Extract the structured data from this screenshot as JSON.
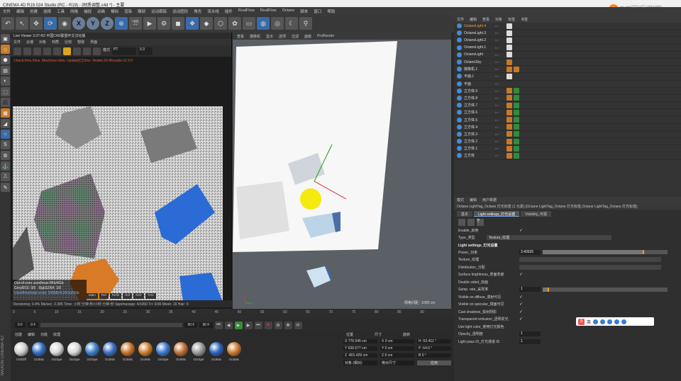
{
  "window": {
    "title": "CINEMA 4D R19.024 Studio (RC - R19) - [材质调整.c4d *] - 主要"
  },
  "brand": {
    "text": "CG帮手学堂"
  },
  "menu": [
    "文件",
    "编辑",
    "创建",
    "选择",
    "工具",
    "网格",
    "捕捉",
    "动画",
    "模拟",
    "渲染",
    "雕刻",
    "运动跟踪",
    "运动图形",
    "角色",
    "流水线",
    "插件",
    "RealFlow",
    "RealFlow",
    "Octane",
    "脚本",
    "窗口",
    "帮助"
  ],
  "toolbar": [
    "↶",
    "↖",
    "✥",
    "⟳",
    "◉",
    "X",
    "Y",
    "Z",
    "⊕",
    "🎬",
    "▶",
    "⚙",
    "◼",
    "❖",
    "◆",
    "⬡",
    "✿",
    "▭",
    "◍",
    "◎",
    "☾",
    "⚲"
  ],
  "left_tools": [
    "▣",
    "◇",
    "⬢",
    "▤",
    "◐",
    "⬚",
    "⬛",
    "▦",
    "◢",
    "⌂",
    "S",
    "⚙",
    "⚓",
    "⎍",
    "✎"
  ],
  "live_viewer": {
    "title": "Live Viewer 3.07-R2 中国C4D联盟中文汉化版",
    "menu": [
      "文件",
      "云端",
      "对象",
      "材质",
      "比较",
      "帮助",
      "界面"
    ],
    "kernel_label": "模式",
    "kernel_value": "PT",
    "kernel_num": "0.3",
    "status": "Check:0ms./0ms. MeshGen:0ms. Update[C]:0ms. Nodes:16 Movable:11 0:0",
    "info": [
      "Out-of-core used/max:0Kb/4Gb",
      "Grey8/16: 0/0",
      "Rgb32/64: 1/0",
      "Used/free/total vram: 566Mb/4.26Gb/6Gb"
    ],
    "info_tabs": [
      "Main",
      "Ref",
      "Refl2",
      "Ref",
      "Refr",
      "Trns"
    ],
    "bottom": "Rendering: 0.4%   Ms/sec: 2.385   Time: 小时:分钟:秒/小时:分钟:秒   Spp/maxspp: 4/1000   Tri: 0/36   Mesh: 16   Hair: 0"
  },
  "viewport": {
    "menu": [
      "查看",
      "摄像机",
      "显示",
      "选项",
      "过滤",
      "面板",
      "ProRender"
    ],
    "grid_label": "网格间距 : 1000 cm"
  },
  "object_manager": {
    "tabs": [
      "文件",
      "编辑",
      "查看",
      "对象",
      "标签",
      "书签"
    ],
    "objects": [
      {
        "name": "OctaneLight.4",
        "selected": true,
        "tags": [
          "w"
        ]
      },
      {
        "name": "OctaneLight.3",
        "selected": false,
        "tags": [
          "w"
        ]
      },
      {
        "name": "OctaneLight.2",
        "selected": false,
        "tags": [
          "w"
        ]
      },
      {
        "name": "OctaneLight.1",
        "selected": false,
        "tags": [
          "w"
        ]
      },
      {
        "name": "OctaneLight",
        "selected": false,
        "tags": [
          "w"
        ]
      },
      {
        "name": "OctaneSky",
        "selected": false,
        "tags": [
          "o"
        ]
      },
      {
        "name": "摄像机.1",
        "selected": false,
        "tags": [
          "o",
          "o"
        ]
      },
      {
        "name": "平面.1",
        "selected": false,
        "tags": [
          "w"
        ]
      },
      {
        "name": "平面",
        "selected": false,
        "tags": []
      },
      {
        "name": "立方体.9",
        "selected": false,
        "tags": [
          "o",
          "g"
        ]
      },
      {
        "name": "立方体.8",
        "selected": false,
        "tags": [
          "o",
          "g"
        ]
      },
      {
        "name": "立方体.7",
        "selected": false,
        "tags": [
          "o",
          "g"
        ]
      },
      {
        "name": "立方体.6",
        "selected": false,
        "tags": [
          "o",
          "g"
        ]
      },
      {
        "name": "立方体.5",
        "selected": false,
        "tags": [
          "o",
          "g"
        ]
      },
      {
        "name": "立方体.4",
        "selected": false,
        "tags": [
          "o",
          "g"
        ]
      },
      {
        "name": "立方体.3",
        "selected": false,
        "tags": [
          "o",
          "g"
        ]
      },
      {
        "name": "立方体.2",
        "selected": false,
        "tags": [
          "o",
          "g"
        ]
      },
      {
        "name": "立方体.1",
        "selected": false,
        "tags": [
          "o",
          "g"
        ]
      },
      {
        "name": "立方体",
        "selected": false,
        "tags": [
          "o",
          "g"
        ]
      }
    ]
  },
  "attributes": {
    "tabs": [
      "模式",
      "编辑",
      "用户数据"
    ],
    "header": "Octane LightTag_Octane 灯光标签 (1 元素) [Octane LightTag_Octane 灯光标签,Octane LightTag_Octane 灯光标签]",
    "subtabs": [
      "基本",
      "Light settings_灯光设置",
      "Visibility_可视"
    ],
    "enable_label": "Enable_启用",
    "type_label": "Type_类型",
    "type_value": "Texture_纹理",
    "section": "Light settings_灯光设置",
    "power_label": "Power_功率",
    "power_value": "3.40525",
    "power_fill": 0.8,
    "texture_label": "Texture_纹理",
    "distribution_label": "Distribution_分配",
    "surface_label": "Surface brightness_表面亮度",
    "double_label": "Double sided_双面",
    "samp_label": "Samp. rate_采样率",
    "samp_value": "1",
    "samp_fill": 0.04,
    "vis_diffuse": "Visible on diffuse_漫射可见",
    "vis_specular": "Visible on specular_镜面可见",
    "cast_shadows": "Cast shadows_投射阴影",
    "transparent": "Transparent emission_透明发光",
    "use_light_color": "Use light color_使用灯光颜色",
    "opacity_label": "Opacity_透明度",
    "opacity_value": "1",
    "light_pass_label": "Light pass ID_灯光通道 ID",
    "light_pass_value": "1"
  },
  "timeline": {
    "ticks": [
      "0",
      "5",
      "10",
      "15",
      "20",
      "25",
      "30",
      "35",
      "40",
      "45",
      "50",
      "55",
      "60",
      "65",
      "70",
      "75",
      "80",
      "85",
      "90"
    ],
    "current": "0 F",
    "start": "0 F",
    "end": "90 F",
    "end2": "90 F"
  },
  "materials": {
    "tabs": [
      "创建",
      "编辑",
      "功能",
      "纹理"
    ],
    "swatches": [
      {
        "name": "OctDiff",
        "color": "#cfcfcf"
      },
      {
        "name": "OctMix",
        "color": "#2f6fc9"
      },
      {
        "name": "OctSpe",
        "color": "#d8d8d8"
      },
      {
        "name": "OctSpe",
        "color": "#d8d8d8"
      },
      {
        "name": "OctSpe",
        "color": "#3a82cc"
      },
      {
        "name": "OctMix",
        "color": "#3a6fc6"
      },
      {
        "name": "OctMix",
        "color": "#c9732b"
      },
      {
        "name": "OctMix",
        "color": "#d0802e"
      },
      {
        "name": "OctSpe",
        "color": "#3b7bd4"
      },
      {
        "name": "OctMix",
        "color": "#c57034"
      },
      {
        "name": "OctSpe",
        "color": "#9a9a9a"
      },
      {
        "name": "OctMix",
        "color": "#2a66c2"
      },
      {
        "name": "OctMix",
        "color": "#cf7a30"
      }
    ]
  },
  "coordinates": {
    "headers": [
      "位置",
      "尺寸",
      "旋转"
    ],
    "rows": [
      [
        "X  776.545 cm",
        "X  0 cm",
        "H  -52.411 °"
      ],
      [
        "Y  636.577 cm",
        "Y  0 cm",
        "P  -54.6 °"
      ],
      [
        "Z  -801.429 cm",
        "Z  0 cm",
        "B  0 °"
      ]
    ],
    "mode": "对象 (相对)",
    "size_mode": "绝对尺寸",
    "apply": "应用"
  },
  "ime": {
    "label": "英"
  },
  "side_logo": "MAXON CINEMA 4D"
}
